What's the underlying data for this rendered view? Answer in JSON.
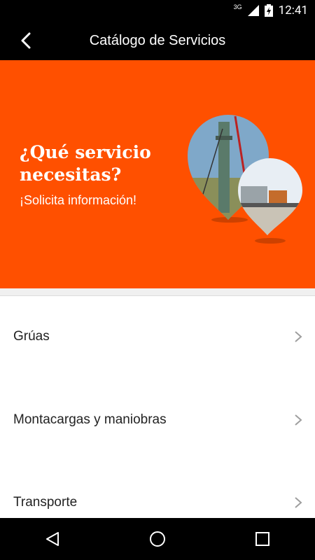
{
  "status_bar": {
    "network": "3G",
    "time": "12:41"
  },
  "app_bar": {
    "title": "Catálogo de Servicios",
    "back_icon": "back-arrow-icon"
  },
  "banner": {
    "background_color": "#ff5000",
    "headline": "¿Qué servicio necesitas?",
    "subheadline": "¡Solicita información!"
  },
  "services": [
    {
      "label": "Grúas"
    },
    {
      "label": "Montacargas y maniobras"
    },
    {
      "label": "Transporte"
    }
  ],
  "nav_bar": {
    "icons": [
      "back-triangle-icon",
      "home-circle-icon",
      "recents-square-icon"
    ]
  }
}
